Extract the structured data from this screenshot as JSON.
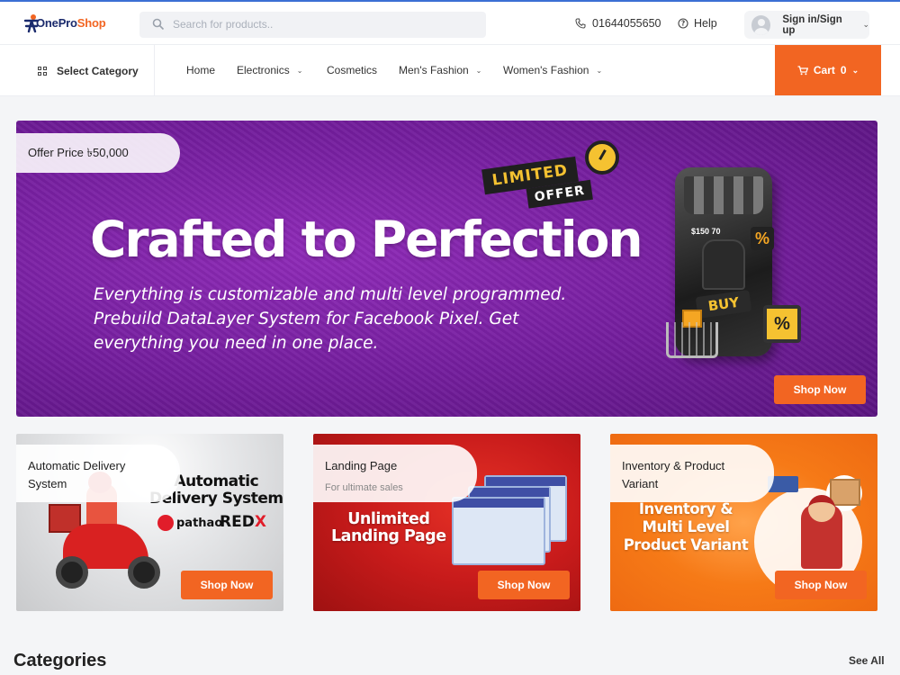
{
  "header": {
    "logo": {
      "one": "One",
      "pro": "Pro",
      "shop": "Shop"
    },
    "search_placeholder": "Search for products..",
    "phone": "01644055650",
    "help": "Help",
    "signin": "Sign in/Sign up"
  },
  "nav": {
    "select_category": "Select Category",
    "items": [
      {
        "label": "Home"
      },
      {
        "label": "Electronics"
      },
      {
        "label": "Cosmetics"
      },
      {
        "label": "Men's Fashion"
      },
      {
        "label": "Women's Fashion"
      }
    ],
    "cart_label": "Cart",
    "cart_count": "0"
  },
  "hero": {
    "offer_price": "Offer Price ৳50,000",
    "limited": "LIMITED",
    "offer": "OFFER",
    "title": "Crafted to Perfection",
    "description": "Everything is customizable and multi level programmed. Prebuild DataLayer System for Facebook Pixel. Get everything you need in one place.",
    "price_tag": "$150 70",
    "pct": "%",
    "buy": "BUY",
    "cta": "Shop Now"
  },
  "cards": [
    {
      "title": "Automatic Delivery System",
      "subtitle": "",
      "art_line1": "Automatic",
      "art_line2": "Delivery System",
      "brand1": "pathao",
      "brand2_a": "RED",
      "brand2_b": "X",
      "cta": "Shop Now"
    },
    {
      "title": "Landing Page",
      "subtitle": "For ultimate sales",
      "art_line1": "Unlimited",
      "art_line2": "Landing Page",
      "cta": "Shop Now"
    },
    {
      "title": "Inventory & Product Variant",
      "subtitle": "",
      "art_line1": "Inventory &",
      "art_line2": "Multi Level",
      "art_line3": "Product Variant",
      "cta": "Shop Now"
    }
  ],
  "categories": {
    "title": "Categories",
    "see_all": "See All"
  },
  "colors": {
    "accent": "#f26522",
    "hero_purple": "#7a1fa2",
    "brand_navy": "#1a2a6c"
  }
}
